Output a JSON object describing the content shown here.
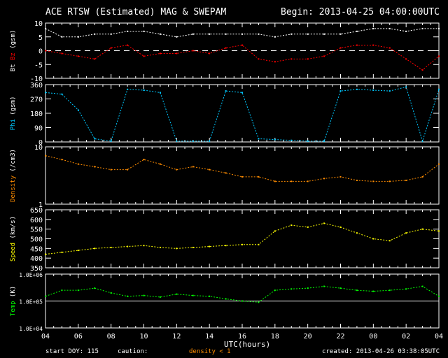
{
  "title": "ACE RTSW (Estimated) MAG & SWEPAM",
  "begin": "Begin: 2013-04-25 04:00:00UTC",
  "footer": {
    "start_doy": "start DOY: 115",
    "caution": "caution:",
    "caution_note": "density < 1",
    "created": "created: 2013-04-26 03:38:05UTC"
  },
  "colors": {
    "bt": "#ffffff",
    "bz": "#ff0000",
    "phi": "#00c8ff",
    "density": "#ff8c00",
    "speed": "#ffff00",
    "temp": "#00ff00"
  },
  "chart_data": [
    {
      "type": "scatter",
      "name": "mag",
      "ylabel": [
        "Bt",
        "Bz",
        "(gsm)"
      ],
      "ylim": [
        -10,
        10
      ],
      "yticks": [
        "10",
        "5",
        "0",
        "-5",
        "-10"
      ],
      "reference_line": 0,
      "x_hours": [
        0,
        1,
        2,
        3,
        4,
        5,
        6,
        7,
        8,
        9,
        10,
        11,
        12,
        13,
        14,
        15,
        16,
        17,
        18,
        19,
        20,
        21,
        22,
        23,
        24
      ],
      "series": [
        {
          "name": "Bt",
          "values": [
            8,
            5,
            5,
            6,
            6,
            7,
            7,
            6,
            5,
            6,
            6,
            6,
            6,
            6,
            5,
            6,
            6,
            6,
            6,
            7,
            8,
            8,
            7,
            8,
            8
          ]
        },
        {
          "name": "Bz",
          "values": [
            0,
            -1,
            -2,
            -3,
            1,
            2,
            -2,
            -1,
            -1,
            0,
            -1,
            1,
            2,
            -3,
            -4,
            -3,
            -3,
            -2,
            1,
            2,
            2,
            1,
            -3,
            -7,
            -2
          ]
        }
      ]
    },
    {
      "type": "scatter",
      "name": "phi",
      "ylabel": [
        "Phi",
        "(gsm)"
      ],
      "ylim": [
        0,
        360
      ],
      "yticks": [
        "360",
        "270",
        "180",
        "90",
        "0"
      ],
      "x_hours": [
        0,
        1,
        2,
        3,
        4,
        5,
        6,
        7,
        8,
        9,
        10,
        11,
        12,
        13,
        14,
        15,
        16,
        17,
        18,
        19,
        20,
        21,
        22,
        23,
        24
      ],
      "series": [
        {
          "name": "Phi",
          "values": [
            310,
            300,
            200,
            20,
            5,
            330,
            325,
            310,
            5,
            5,
            5,
            320,
            310,
            20,
            15,
            10,
            5,
            5,
            320,
            330,
            325,
            320,
            345,
            5,
            330
          ]
        }
      ]
    },
    {
      "type": "scatter",
      "name": "density",
      "ylabel": [
        "Density",
        "(/cm3)"
      ],
      "scale": "log",
      "ylim": [
        1,
        10
      ],
      "yticks": [
        "10",
        "1"
      ],
      "x_hours": [
        0,
        1,
        2,
        3,
        4,
        5,
        6,
        7,
        8,
        9,
        10,
        11,
        12,
        13,
        14,
        15,
        16,
        17,
        18,
        19,
        20,
        21,
        22,
        23,
        24
      ],
      "series": [
        {
          "name": "Density",
          "values": [
            7,
            6,
            5,
            4.5,
            4,
            4,
            6,
            5,
            4,
            4.5,
            4,
            3.5,
            3,
            3,
            2.5,
            2.5,
            2.5,
            2.8,
            3,
            2.6,
            2.5,
            2.5,
            2.6,
            3,
            5
          ]
        }
      ]
    },
    {
      "type": "scatter",
      "name": "speed",
      "ylabel": [
        "Speed",
        "(km/s)"
      ],
      "ylim": [
        350,
        650
      ],
      "yticks": [
        "650",
        "600",
        "550",
        "500",
        "450",
        "400",
        "350"
      ],
      "x_hours": [
        0,
        1,
        2,
        3,
        4,
        5,
        6,
        7,
        8,
        9,
        10,
        11,
        12,
        13,
        14,
        15,
        16,
        17,
        18,
        19,
        20,
        21,
        22,
        23,
        24
      ],
      "series": [
        {
          "name": "Speed",
          "values": [
            420,
            430,
            440,
            450,
            455,
            460,
            465,
            455,
            450,
            455,
            460,
            465,
            470,
            470,
            540,
            570,
            560,
            580,
            560,
            530,
            500,
            490,
            530,
            550,
            540
          ]
        }
      ]
    },
    {
      "type": "scatter",
      "name": "temp",
      "ylabel": [
        "Temp",
        "(K)"
      ],
      "scale": "log",
      "ylim": [
        10000,
        1000000
      ],
      "yticks": [
        "1.0E+06",
        "1.0E+05",
        "1.0E+04"
      ],
      "reference_line": 100000,
      "x_hours": [
        0,
        1,
        2,
        3,
        4,
        5,
        6,
        7,
        8,
        9,
        10,
        11,
        12,
        13,
        14,
        15,
        16,
        17,
        18,
        19,
        20,
        21,
        22,
        23,
        24
      ],
      "series": [
        {
          "name": "Temp",
          "values": [
            150000,
            250000,
            250000,
            300000,
            200000,
            150000,
            160000,
            140000,
            180000,
            160000,
            150000,
            120000,
            100000,
            90000,
            250000,
            280000,
            300000,
            350000,
            300000,
            250000,
            230000,
            250000,
            280000,
            350000,
            150000
          ]
        }
      ]
    }
  ],
  "xaxis": {
    "label": "UTC(hours)",
    "ticks": [
      "04",
      "06",
      "08",
      "10",
      "12",
      "14",
      "16",
      "18",
      "20",
      "22",
      "00",
      "02",
      "04"
    ]
  }
}
